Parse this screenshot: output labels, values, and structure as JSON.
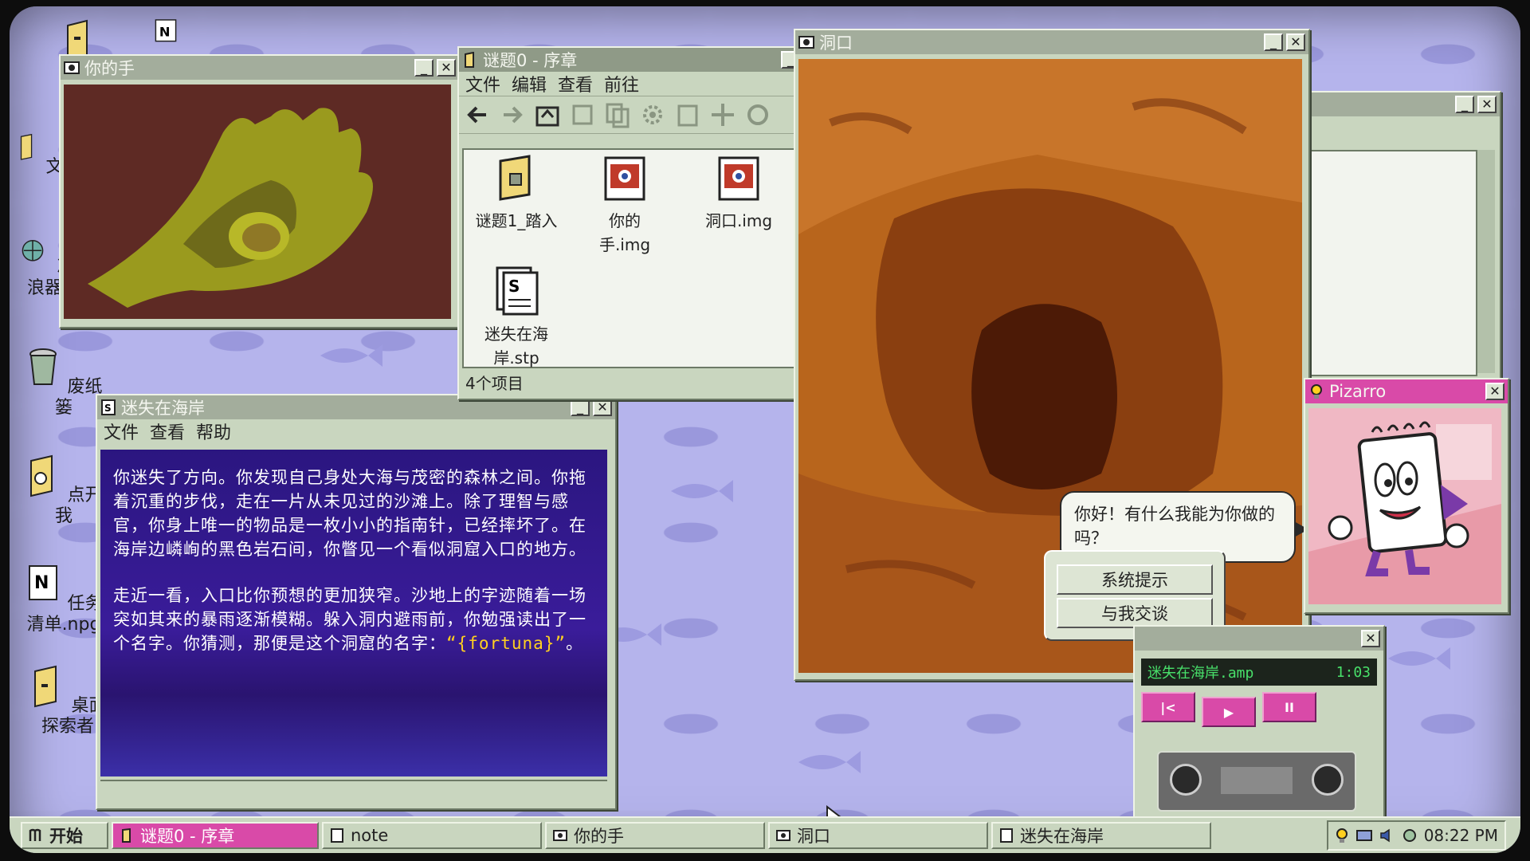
{
  "desktop_icons": [
    {
      "label": "",
      "icon": "folder-icon"
    },
    {
      "label": "",
      "icon": "notepad-icon"
    },
    {
      "label": "文",
      "icon": "document-icon"
    },
    {
      "label": "冲浪器",
      "icon": "globe-icon"
    },
    {
      "label": "废纸篓",
      "icon": "trash-icon"
    },
    {
      "label": "点开我",
      "icon": "folder-hand-icon"
    },
    {
      "label": "任务清单.npg",
      "icon": "notepad-icon"
    },
    {
      "label": "桌面探索者",
      "icon": "folder-icon"
    }
  ],
  "hand_window": {
    "title": "你的手"
  },
  "explorer": {
    "title": "谜题0 - 序章",
    "menu": [
      "文件",
      "编辑",
      "查看",
      "前往"
    ],
    "files": [
      {
        "name": "谜题1_踏入",
        "icon": "puzzle-folder-icon"
      },
      {
        "name": "你的手.img",
        "icon": "image-file-icon"
      },
      {
        "name": "洞口.img",
        "icon": "image-file-icon"
      },
      {
        "name": "迷失在海岸.stp",
        "icon": "story-file-icon"
      }
    ],
    "status": "4个项目"
  },
  "story_window": {
    "title": "迷失在海岸",
    "menu": [
      "文件",
      "查看",
      "帮助"
    ],
    "paragraph1": "你迷失了方向。你发现自己身处大海与茂密的森林之间。你拖着沉重的步伐，走在一片从未见过的沙滩上。除了理智与感官，你身上唯一的物品是一枚小小的指南针，已经摔坏了。在海岸边嶙峋的黑色岩石间，你瞥见一个看似洞窟入口的地方。",
    "paragraph2_before": "走近一看，入口比你预想的更加狭窄。沙地上的字迹随着一场突如其来的暴雨逐渐模糊。躲入洞内避雨前，你勉强读出了一个名字。你猜测，那便是这个洞窟的名字：",
    "highlight": "“{fortuna}”",
    "paragraph2_after": "。"
  },
  "cave_window": {
    "title": "洞口"
  },
  "pizarro": {
    "title": "Pizarro",
    "speech": "你好！有什么我能为你做的吗？",
    "buttons": [
      "系统提示",
      "与我交谈"
    ]
  },
  "player": {
    "track": "迷失在海岸.amp",
    "time": "1:03",
    "prev": "|<",
    "play": "▶",
    "pause": "II"
  },
  "taskbar": {
    "start": "开始",
    "tasks": [
      "谜题0 - 序章",
      "note",
      "你的手",
      "洞口",
      "迷失在海岸"
    ],
    "clock": "08:22 PM"
  },
  "colors": {
    "desktop": "#b5b4ec",
    "window": "#c9d6bf",
    "story_bg": "#2a1675",
    "highlight": "#ffd020",
    "cave": "#b8651c",
    "pink_title": "#d94aa8"
  }
}
